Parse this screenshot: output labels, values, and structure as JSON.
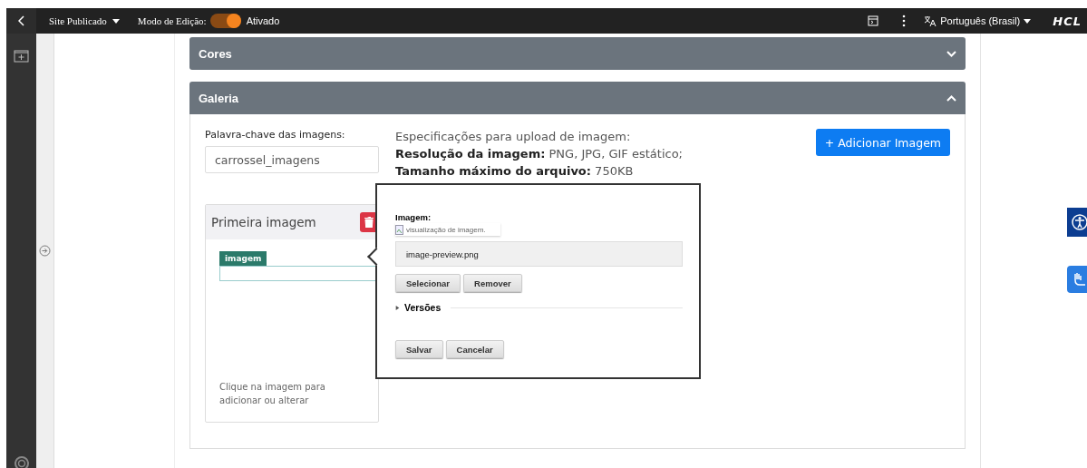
{
  "top_bar": {
    "site_menu": "Site Publicado",
    "edit_mode": {
      "label": "Modo de Edição:",
      "on": true,
      "state_text": "Ativado"
    },
    "language": "Português (Brasil)",
    "logo": "HCL"
  },
  "sections": [
    {
      "title": "Cores",
      "expanded": false
    },
    {
      "title": "Galeria",
      "expanded": true
    }
  ],
  "gallery": {
    "keyword_label": "Palavra-chave das imagens:",
    "keyword_value": "carrossel_imagens",
    "specs_title": "Especificações para upload de imagem:",
    "specs": [
      "**Resolução da imagem:** PNG, JPG, GIF estático;",
      "**Tamanho máximo do arquivo:** 750KB"
    ],
    "add_button": "+ Adicionar Imagem",
    "card": {
      "title": "Primeira imagem",
      "tag": "imagem",
      "hint": "Clique na imagem para adicionar ou alterar"
    }
  },
  "popup": {
    "label": "Imagem:",
    "image_alt": "visualização de imagem.",
    "file_name": "image-preview.png",
    "file_buttons": [
      "Selecionar",
      "Remover"
    ],
    "versions": {
      "label": "Versões",
      "expanded": false
    },
    "buttons": [
      "Salvar",
      "Cancelar"
    ]
  }
}
